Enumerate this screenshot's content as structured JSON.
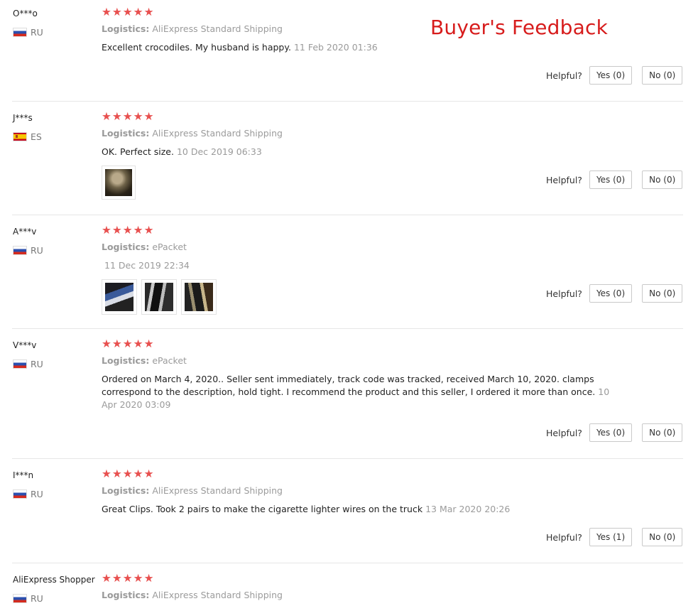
{
  "banner": "Buyer's Feedback",
  "labels": {
    "logistics": "Logistics:",
    "helpful": "Helpful?"
  },
  "stars_text": "★★★★★",
  "reviews": [
    {
      "user": "O***o",
      "country": "RU",
      "rating": 5,
      "logistics": "AliExpress Standard Shipping",
      "text": "Excellent crocodiles. My husband is happy.",
      "date": "11 Feb 2020 01:36",
      "photos": 0,
      "yes_label": "Yes (0)",
      "no_label": "No (0)"
    },
    {
      "user": "J***s",
      "country": "ES",
      "rating": 5,
      "logistics": "AliExpress Standard Shipping",
      "text": "OK. Perfect size.",
      "date": "10 Dec 2019 06:33",
      "photos": 1,
      "yes_label": "Yes (0)",
      "no_label": "No (0)"
    },
    {
      "user": "A***v",
      "country": "RU",
      "rating": 5,
      "logistics": "ePacket",
      "text": "",
      "date": "11 Dec 2019 22:34",
      "photos": 3,
      "yes_label": "Yes (0)",
      "no_label": "No (0)"
    },
    {
      "user": "V***v",
      "country": "RU",
      "rating": 5,
      "logistics": "ePacket",
      "text": "Ordered on March 4, 2020.. Seller sent immediately, track code was tracked, received March 10, 2020. clamps correspond to the description, hold tight. I recommend the product and this seller, I ordered it more than once.",
      "date": "10 Apr 2020 03:09",
      "photos": 0,
      "yes_label": "Yes (0)",
      "no_label": "No (0)"
    },
    {
      "user": "I***n",
      "country": "RU",
      "rating": 5,
      "logistics": "AliExpress Standard Shipping",
      "text": "Great Clips. Took 2 pairs to make the cigarette lighter wires on the truck",
      "date": "13 Mar 2020 20:26",
      "photos": 0,
      "yes_label": "Yes (1)",
      "no_label": "No (0)"
    },
    {
      "user": "AliExpress Shopper",
      "country": "RU",
      "rating": 5,
      "logistics": "AliExpress Standard Shipping",
      "text": "",
      "date": "",
      "photos": 0,
      "yes_label": "",
      "no_label": ""
    }
  ],
  "colors": {
    "banner": "#d71c1c",
    "star": "#e8504f",
    "muted": "#9a9a9a"
  }
}
